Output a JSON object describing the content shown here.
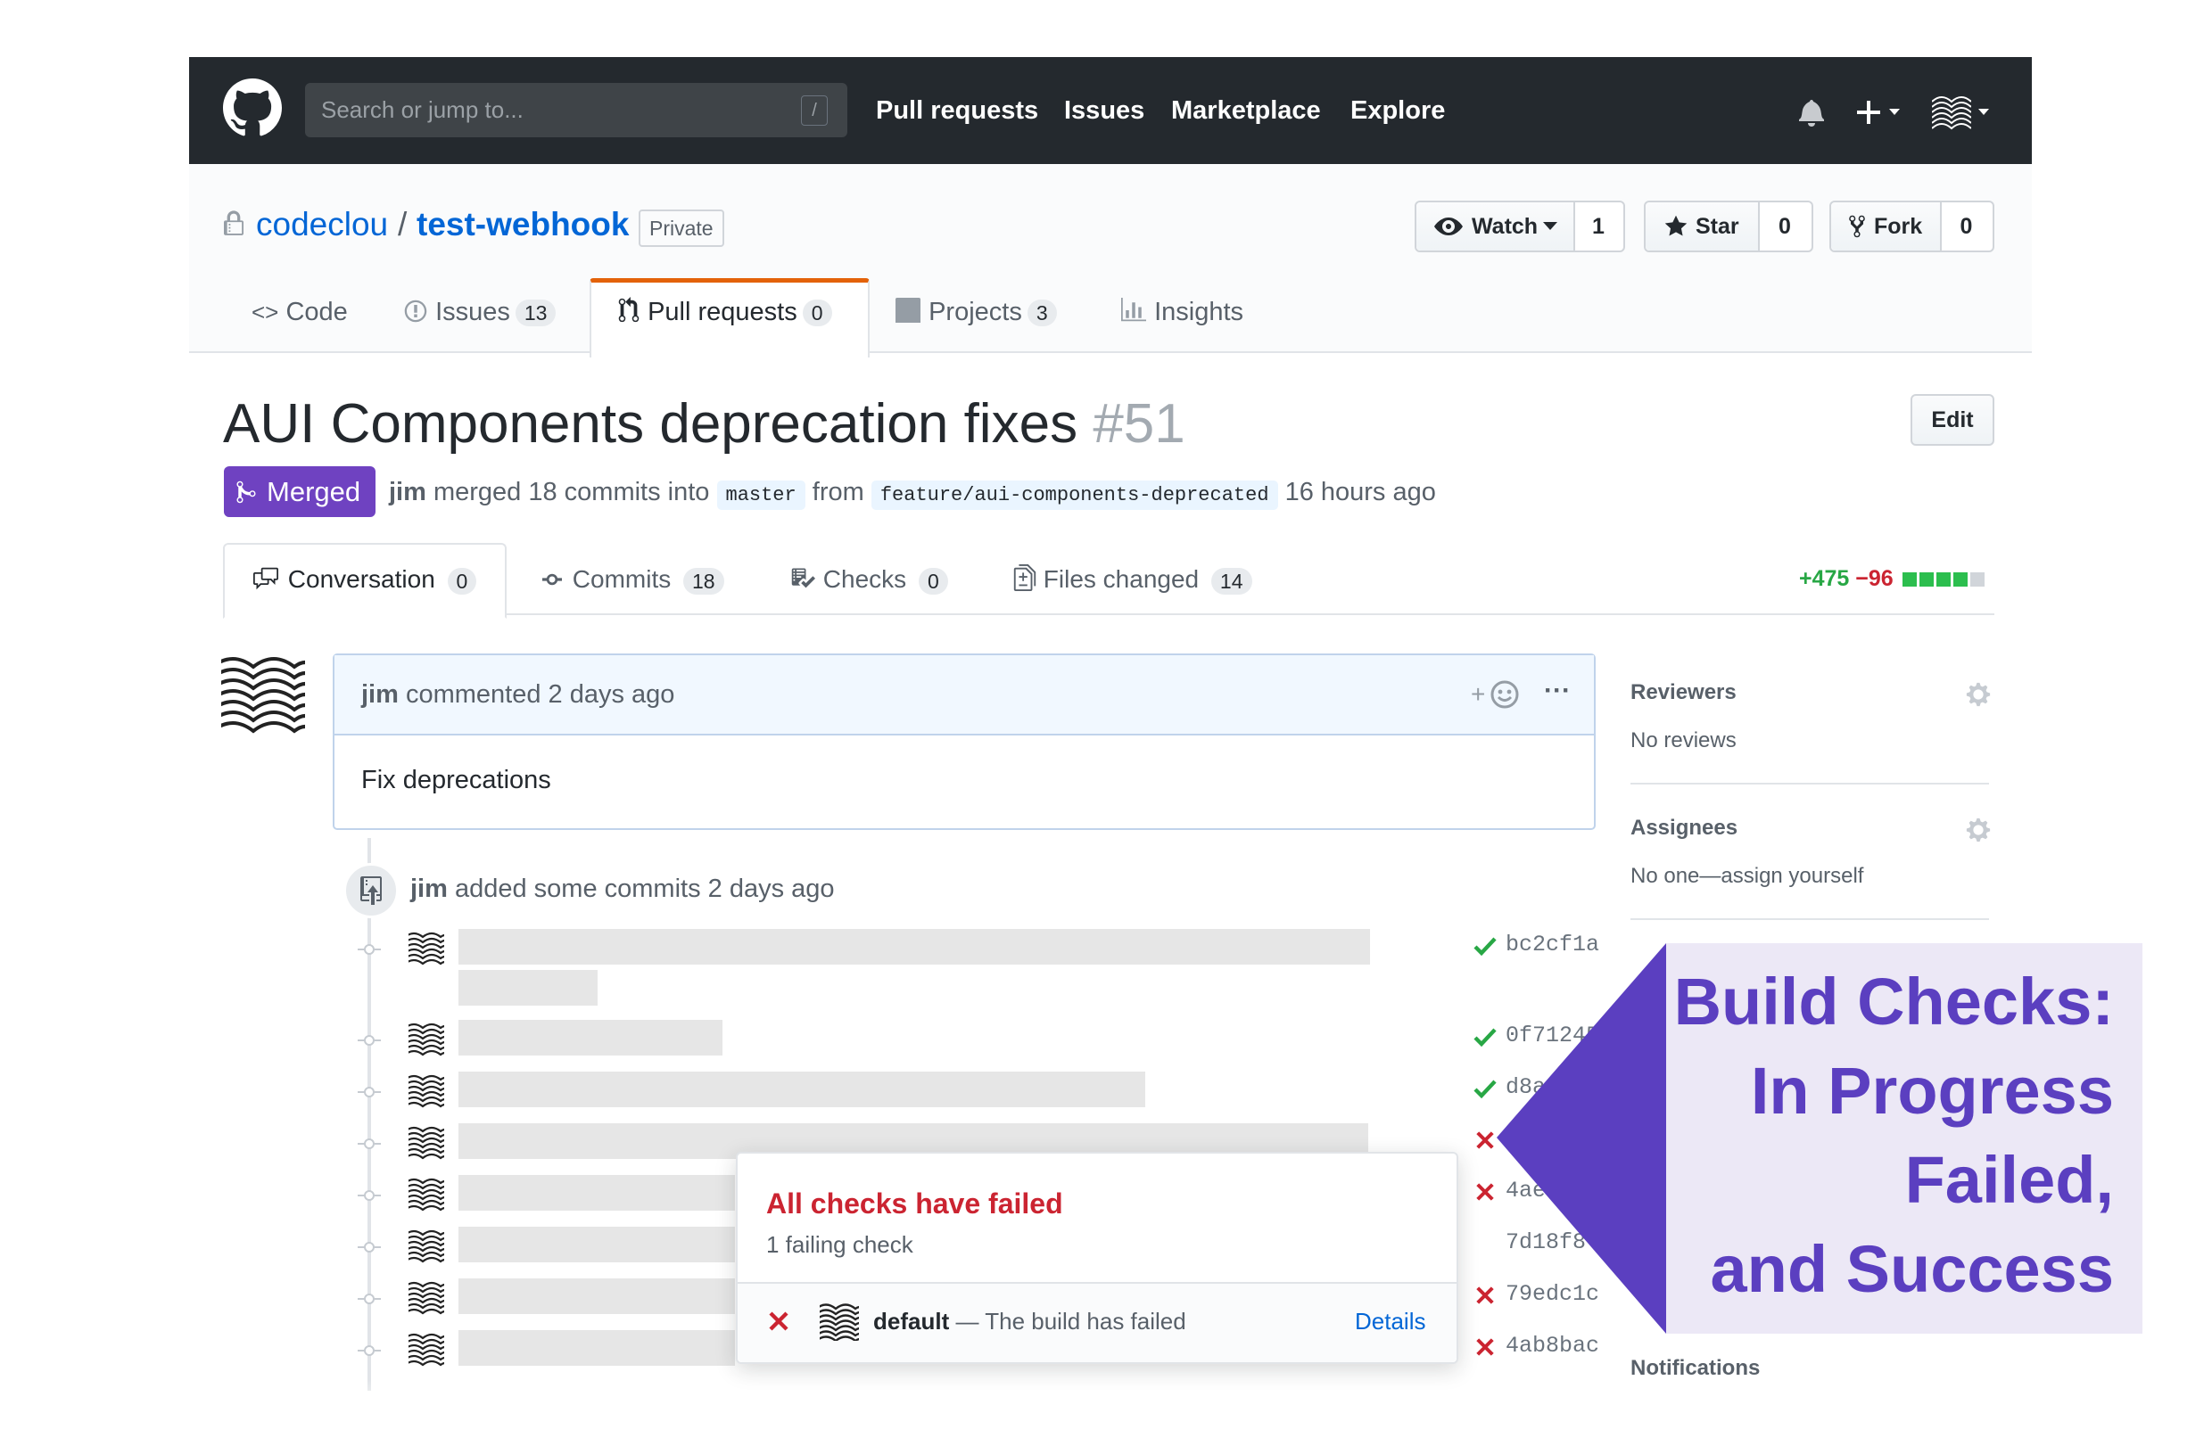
{
  "header": {
    "search_placeholder": "Search or jump to...",
    "search_shortcut": "/",
    "nav": [
      "Pull requests",
      "Issues",
      "Marketplace",
      "Explore"
    ],
    "icons": [
      "github-logo-icon",
      "bell-icon",
      "plus-icon",
      "avatar"
    ]
  },
  "repo": {
    "owner": "codeclou",
    "separator": "/",
    "name": "test-webhook",
    "visibility": "Private",
    "watch_label": "Watch",
    "watch_count": "1",
    "star_label": "Star",
    "star_count": "0",
    "fork_label": "Fork",
    "fork_count": "0",
    "tabs": [
      {
        "label": "Code",
        "count": ""
      },
      {
        "label": "Issues",
        "count": "13"
      },
      {
        "label": "Pull requests",
        "count": "0"
      },
      {
        "label": "Projects",
        "count": "3"
      },
      {
        "label": "Insights",
        "count": ""
      }
    ]
  },
  "pr": {
    "title": "AUI Components deprecation fixes",
    "number": "#51",
    "edit_label": "Edit",
    "state": "Merged",
    "author": "jim",
    "merged_text": "merged 18 commits into",
    "base_branch": "master",
    "from_text": "from",
    "head_branch": "feature/aui-components-deprecated",
    "time": "16 hours ago",
    "tabs": [
      {
        "label": "Conversation",
        "count": "0"
      },
      {
        "label": "Commits",
        "count": "18"
      },
      {
        "label": "Checks",
        "count": "0"
      },
      {
        "label": "Files changed",
        "count": "14"
      }
    ],
    "additions": "+475",
    "deletions": "−96"
  },
  "comment": {
    "author": "jim",
    "action": "commented 2 days ago",
    "reaction_plus": "+",
    "more": "···",
    "body": "Fix deprecations"
  },
  "timeline": {
    "event_author": "jim",
    "event_text": "added some commits 2 days ago",
    "commits": [
      {
        "sha": "bc2cf1a",
        "status": "success"
      },
      {
        "sha": "0f71245",
        "status": "success"
      },
      {
        "sha": "d8a",
        "status": "success"
      },
      {
        "sha": "",
        "status": "failure"
      },
      {
        "sha": "4ae",
        "status": "failure"
      },
      {
        "sha": "7d18f8",
        "status": "none"
      },
      {
        "sha": "79edc1c",
        "status": "failure"
      },
      {
        "sha": "4ab8bac",
        "status": "failure"
      }
    ]
  },
  "sidebar": {
    "reviewers_heading": "Reviewers",
    "reviewers_value": "No reviews",
    "assignees_heading": "Assignees",
    "assignees_value": "No one—assign yourself",
    "notifications_heading": "Notifications"
  },
  "popup": {
    "title": "All checks have failed",
    "subtitle": "1 failing check",
    "check_name": "default",
    "check_desc": "— The build has failed",
    "details_label": "Details"
  },
  "callout": {
    "lines": [
      "Build Checks:",
      "In  Progress",
      "Failed,",
      "and Success"
    ]
  },
  "colors": {
    "header_bg": "#24292e",
    "link": "#0366d6",
    "merged": "#6f42c1",
    "success": "#28a745",
    "failure": "#cb2431",
    "callout_text": "#5b3fc0",
    "callout_bg": "#ece8f6"
  }
}
